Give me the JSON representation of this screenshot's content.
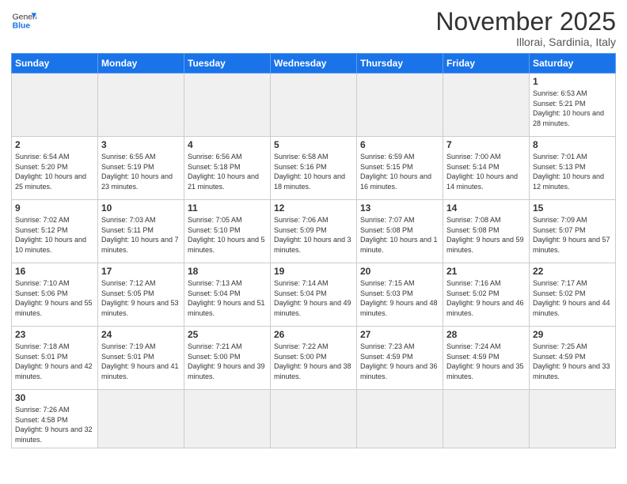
{
  "logo": {
    "text_normal": "General",
    "text_bold": "Blue"
  },
  "title": "November 2025",
  "subtitle": "Illorai, Sardinia, Italy",
  "days_header": [
    "Sunday",
    "Monday",
    "Tuesday",
    "Wednesday",
    "Thursday",
    "Friday",
    "Saturday"
  ],
  "weeks": [
    [
      {
        "day": "",
        "info": ""
      },
      {
        "day": "",
        "info": ""
      },
      {
        "day": "",
        "info": ""
      },
      {
        "day": "",
        "info": ""
      },
      {
        "day": "",
        "info": ""
      },
      {
        "day": "",
        "info": ""
      },
      {
        "day": "1",
        "info": "Sunrise: 6:53 AM\nSunset: 5:21 PM\nDaylight: 10 hours\nand 28 minutes."
      }
    ],
    [
      {
        "day": "2",
        "info": "Sunrise: 6:54 AM\nSunset: 5:20 PM\nDaylight: 10 hours\nand 25 minutes."
      },
      {
        "day": "3",
        "info": "Sunrise: 6:55 AM\nSunset: 5:19 PM\nDaylight: 10 hours\nand 23 minutes."
      },
      {
        "day": "4",
        "info": "Sunrise: 6:56 AM\nSunset: 5:18 PM\nDaylight: 10 hours\nand 21 minutes."
      },
      {
        "day": "5",
        "info": "Sunrise: 6:58 AM\nSunset: 5:16 PM\nDaylight: 10 hours\nand 18 minutes."
      },
      {
        "day": "6",
        "info": "Sunrise: 6:59 AM\nSunset: 5:15 PM\nDaylight: 10 hours\nand 16 minutes."
      },
      {
        "day": "7",
        "info": "Sunrise: 7:00 AM\nSunset: 5:14 PM\nDaylight: 10 hours\nand 14 minutes."
      },
      {
        "day": "8",
        "info": "Sunrise: 7:01 AM\nSunset: 5:13 PM\nDaylight: 10 hours\nand 12 minutes."
      }
    ],
    [
      {
        "day": "9",
        "info": "Sunrise: 7:02 AM\nSunset: 5:12 PM\nDaylight: 10 hours\nand 10 minutes."
      },
      {
        "day": "10",
        "info": "Sunrise: 7:03 AM\nSunset: 5:11 PM\nDaylight: 10 hours\nand 7 minutes."
      },
      {
        "day": "11",
        "info": "Sunrise: 7:05 AM\nSunset: 5:10 PM\nDaylight: 10 hours\nand 5 minutes."
      },
      {
        "day": "12",
        "info": "Sunrise: 7:06 AM\nSunset: 5:09 PM\nDaylight: 10 hours\nand 3 minutes."
      },
      {
        "day": "13",
        "info": "Sunrise: 7:07 AM\nSunset: 5:08 PM\nDaylight: 10 hours\nand 1 minute."
      },
      {
        "day": "14",
        "info": "Sunrise: 7:08 AM\nSunset: 5:08 PM\nDaylight: 9 hours\nand 59 minutes."
      },
      {
        "day": "15",
        "info": "Sunrise: 7:09 AM\nSunset: 5:07 PM\nDaylight: 9 hours\nand 57 minutes."
      }
    ],
    [
      {
        "day": "16",
        "info": "Sunrise: 7:10 AM\nSunset: 5:06 PM\nDaylight: 9 hours\nand 55 minutes."
      },
      {
        "day": "17",
        "info": "Sunrise: 7:12 AM\nSunset: 5:05 PM\nDaylight: 9 hours\nand 53 minutes."
      },
      {
        "day": "18",
        "info": "Sunrise: 7:13 AM\nSunset: 5:04 PM\nDaylight: 9 hours\nand 51 minutes."
      },
      {
        "day": "19",
        "info": "Sunrise: 7:14 AM\nSunset: 5:04 PM\nDaylight: 9 hours\nand 49 minutes."
      },
      {
        "day": "20",
        "info": "Sunrise: 7:15 AM\nSunset: 5:03 PM\nDaylight: 9 hours\nand 48 minutes."
      },
      {
        "day": "21",
        "info": "Sunrise: 7:16 AM\nSunset: 5:02 PM\nDaylight: 9 hours\nand 46 minutes."
      },
      {
        "day": "22",
        "info": "Sunrise: 7:17 AM\nSunset: 5:02 PM\nDaylight: 9 hours\nand 44 minutes."
      }
    ],
    [
      {
        "day": "23",
        "info": "Sunrise: 7:18 AM\nSunset: 5:01 PM\nDaylight: 9 hours\nand 42 minutes."
      },
      {
        "day": "24",
        "info": "Sunrise: 7:19 AM\nSunset: 5:01 PM\nDaylight: 9 hours\nand 41 minutes."
      },
      {
        "day": "25",
        "info": "Sunrise: 7:21 AM\nSunset: 5:00 PM\nDaylight: 9 hours\nand 39 minutes."
      },
      {
        "day": "26",
        "info": "Sunrise: 7:22 AM\nSunset: 5:00 PM\nDaylight: 9 hours\nand 38 minutes."
      },
      {
        "day": "27",
        "info": "Sunrise: 7:23 AM\nSunset: 4:59 PM\nDaylight: 9 hours\nand 36 minutes."
      },
      {
        "day": "28",
        "info": "Sunrise: 7:24 AM\nSunset: 4:59 PM\nDaylight: 9 hours\nand 35 minutes."
      },
      {
        "day": "29",
        "info": "Sunrise: 7:25 AM\nSunset: 4:59 PM\nDaylight: 9 hours\nand 33 minutes."
      }
    ],
    [
      {
        "day": "30",
        "info": "Sunrise: 7:26 AM\nSunset: 4:58 PM\nDaylight: 9 hours\nand 32 minutes."
      },
      {
        "day": "",
        "info": ""
      },
      {
        "day": "",
        "info": ""
      },
      {
        "day": "",
        "info": ""
      },
      {
        "day": "",
        "info": ""
      },
      {
        "day": "",
        "info": ""
      },
      {
        "day": "",
        "info": ""
      }
    ]
  ]
}
